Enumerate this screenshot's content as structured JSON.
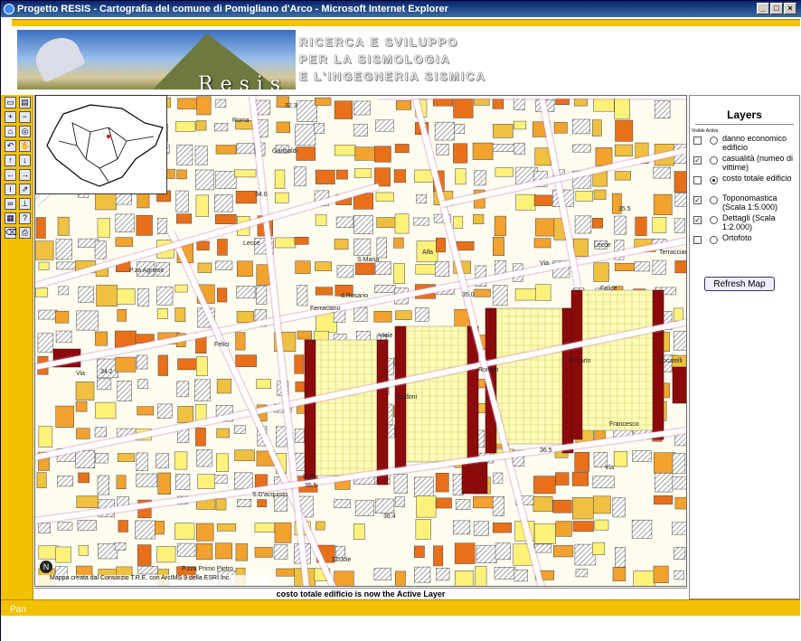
{
  "window": {
    "title": "Progetto RESIS - Cartografia del comune di Pomigliano d'Arco - Microsoft Internet Explorer"
  },
  "banner": {
    "logo_text": "Resis",
    "tagline": [
      "RICERCA E SVILUPPO",
      "PER LA SISMOLOGIA",
      "E L'INGEGNERIA SISMICA"
    ]
  },
  "toolbar": {
    "tools": [
      "toggle-overview-icon",
      "toggle-legend-icon",
      "zoom-in-icon",
      "zoom-out-icon",
      "zoom-full-icon",
      "zoom-active-icon",
      "zoom-previous-icon",
      "pan-hand-icon",
      "pan-up-icon",
      "pan-down-icon",
      "pan-left-icon",
      "pan-right-icon",
      "identify-icon",
      "hyperlink-icon",
      "find-binoculars-icon",
      "measure-icon",
      "select-rect-icon",
      "query-icon",
      "clear-selection-icon",
      "print-icon"
    ]
  },
  "map": {
    "labels": [
      "Roma",
      "Garibaldi",
      "32.3",
      "34.0",
      "34.2",
      "35.0",
      "35.5",
      "35.5",
      "36.5",
      "36.4",
      "Via",
      "Felici",
      "Ferraciano",
      "d.Rosario",
      "S.Maria",
      "P.za Agnese",
      "Alfa",
      "Viale",
      "Guidoni",
      "Romeo",
      "Ferrarin",
      "Locatelli",
      "Francesco",
      "Lecce",
      "Terracciano",
      "Felice",
      "P.za",
      "S.D'acquisto",
      "Scuole",
      "P.zza Primo Pietro",
      "Via",
      "Via",
      "Lecce",
      "C"
    ],
    "copyright": "Mappa creata dal Consorzio T.R.E. con ArcIMS 9 della ESRI Inc."
  },
  "status": {
    "active_layer_msg": "costo totale edificio is now the Active Layer"
  },
  "layers": {
    "title": "Layers",
    "columns": "Visible Active",
    "items": [
      {
        "label": "danno economico edificio",
        "visible": false,
        "active": false
      },
      {
        "label": "casualità (numeo di vittime)",
        "visible": true,
        "active": false
      },
      {
        "label": "costo totale edificio",
        "visible": false,
        "active": true
      },
      {
        "label": "Toponomastica (Scala 1:5.000)",
        "visible": true,
        "active": false
      },
      {
        "label": "Dettagli (Scala 1:2.000)",
        "visible": true,
        "active": false
      },
      {
        "label": "Ortofoto",
        "visible": false,
        "active": false
      }
    ],
    "refresh_label": "Refresh Map"
  },
  "footer": {
    "mode": "Pan"
  },
  "colors": {
    "accent": "#f2c200",
    "titlebar": "#0a246a",
    "high_cost": "#8b0a0a",
    "mid_cost": "#e8701a",
    "low_cost": "#f2a22e",
    "building_hatch": "#555555"
  }
}
